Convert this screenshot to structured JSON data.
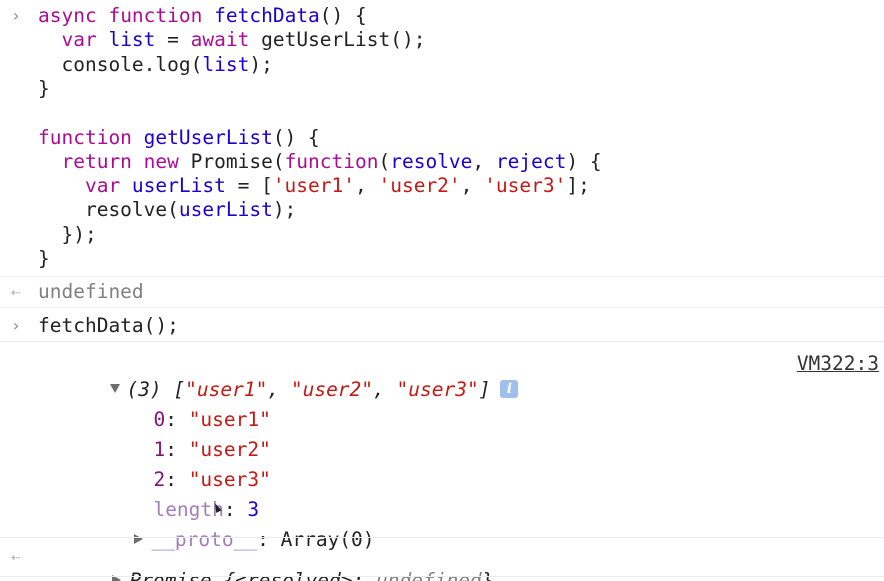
{
  "code_input": {
    "lines": [
      [
        {
          "t": "async ",
          "c": "kw"
        },
        {
          "t": "function ",
          "c": "kw"
        },
        {
          "t": "fetchData",
          "c": "fn"
        },
        {
          "t": "() {",
          "c": "plain"
        }
      ],
      [
        {
          "t": "  var ",
          "c": "kw"
        },
        {
          "t": "list",
          "c": "fn"
        },
        {
          "t": " = ",
          "c": "plain"
        },
        {
          "t": "await ",
          "c": "kw"
        },
        {
          "t": "getUserList();",
          "c": "plain"
        }
      ],
      [
        {
          "t": "  console.log(",
          "c": "plain"
        },
        {
          "t": "list",
          "c": "fn"
        },
        {
          "t": ");",
          "c": "plain"
        }
      ],
      [
        {
          "t": "}",
          "c": "plain"
        }
      ],
      [
        {
          "t": "",
          "c": "plain"
        }
      ],
      [
        {
          "t": "function ",
          "c": "kw"
        },
        {
          "t": "getUserList",
          "c": "fn"
        },
        {
          "t": "() {",
          "c": "plain"
        }
      ],
      [
        {
          "t": "  return ",
          "c": "kw"
        },
        {
          "t": "new ",
          "c": "kw"
        },
        {
          "t": "Promise(",
          "c": "plain"
        },
        {
          "t": "function",
          "c": "kw"
        },
        {
          "t": "(",
          "c": "plain"
        },
        {
          "t": "resolve",
          "c": "fn"
        },
        {
          "t": ", ",
          "c": "plain"
        },
        {
          "t": "reject",
          "c": "fn"
        },
        {
          "t": ") {",
          "c": "plain"
        }
      ],
      [
        {
          "t": "    var ",
          "c": "kw"
        },
        {
          "t": "userList",
          "c": "fn"
        },
        {
          "t": " = [",
          "c": "plain"
        },
        {
          "t": "'user1'",
          "c": "str"
        },
        {
          "t": ", ",
          "c": "plain"
        },
        {
          "t": "'user2'",
          "c": "str"
        },
        {
          "t": ", ",
          "c": "plain"
        },
        {
          "t": "'user3'",
          "c": "str"
        },
        {
          "t": "];",
          "c": "plain"
        }
      ],
      [
        {
          "t": "    resolve(",
          "c": "plain"
        },
        {
          "t": "userList",
          "c": "fn"
        },
        {
          "t": ");",
          "c": "plain"
        }
      ],
      [
        {
          "t": "  });",
          "c": "plain"
        }
      ],
      [
        {
          "t": "}",
          "c": "plain"
        }
      ]
    ]
  },
  "result1": {
    "text": "undefined"
  },
  "input2": {
    "text": "fetchData();"
  },
  "log_output": {
    "summary_count": "(3) ",
    "summary_items": [
      "\"user1\"",
      "\"user2\"",
      "\"user3\""
    ],
    "source_link": "VM322:3",
    "info_icon": "i",
    "entries": [
      {
        "key": "0",
        "value": "\"user1\""
      },
      {
        "key": "1",
        "value": "\"user2\""
      },
      {
        "key": "2",
        "value": "\"user3\""
      }
    ],
    "length_key": "length",
    "length_value": "3",
    "proto_key": "__proto__",
    "proto_value": "Array(0)"
  },
  "result2": {
    "promise_label": "Promise ",
    "promise_open": "{",
    "promise_state_key": "<resolved>",
    "promise_state_sep": ": ",
    "promise_state_value": "undefined",
    "promise_close": "}"
  },
  "colors": {
    "keyword": "#aa0d91",
    "identifier": "#1c00cf",
    "string": "#c41a16",
    "property": "#881280"
  },
  "icons": {
    "input_prompt": "chevron-right-icon",
    "result_prompt": "result-arrow-icon",
    "expand": "triangle-down-icon",
    "collapse": "triangle-right-icon",
    "info": "info-icon"
  }
}
